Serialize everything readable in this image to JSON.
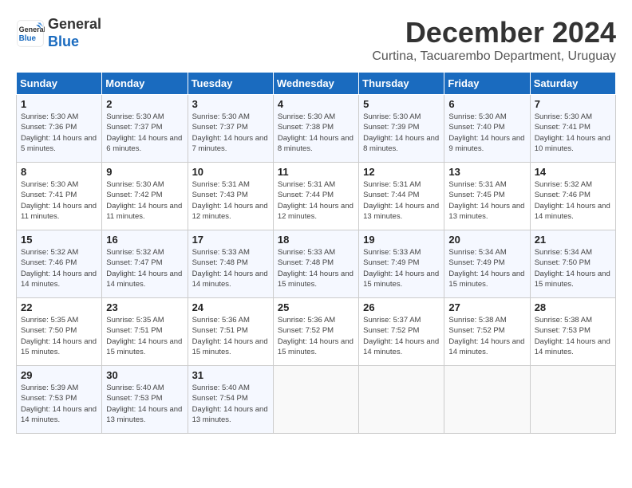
{
  "logo": {
    "line1": "General",
    "line2": "Blue"
  },
  "title": "December 2024",
  "subtitle": "Curtina, Tacuarembo Department, Uruguay",
  "weekdays": [
    "Sunday",
    "Monday",
    "Tuesday",
    "Wednesday",
    "Thursday",
    "Friday",
    "Saturday"
  ],
  "weeks": [
    [
      {
        "day": "1",
        "sunrise": "5:30 AM",
        "sunset": "7:36 PM",
        "daylight": "14 hours and 5 minutes."
      },
      {
        "day": "2",
        "sunrise": "5:30 AM",
        "sunset": "7:37 PM",
        "daylight": "14 hours and 6 minutes."
      },
      {
        "day": "3",
        "sunrise": "5:30 AM",
        "sunset": "7:37 PM",
        "daylight": "14 hours and 7 minutes."
      },
      {
        "day": "4",
        "sunrise": "5:30 AM",
        "sunset": "7:38 PM",
        "daylight": "14 hours and 8 minutes."
      },
      {
        "day": "5",
        "sunrise": "5:30 AM",
        "sunset": "7:39 PM",
        "daylight": "14 hours and 8 minutes."
      },
      {
        "day": "6",
        "sunrise": "5:30 AM",
        "sunset": "7:40 PM",
        "daylight": "14 hours and 9 minutes."
      },
      {
        "day": "7",
        "sunrise": "5:30 AM",
        "sunset": "7:41 PM",
        "daylight": "14 hours and 10 minutes."
      }
    ],
    [
      {
        "day": "8",
        "sunrise": "5:30 AM",
        "sunset": "7:41 PM",
        "daylight": "14 hours and 11 minutes."
      },
      {
        "day": "9",
        "sunrise": "5:30 AM",
        "sunset": "7:42 PM",
        "daylight": "14 hours and 11 minutes."
      },
      {
        "day": "10",
        "sunrise": "5:31 AM",
        "sunset": "7:43 PM",
        "daylight": "14 hours and 12 minutes."
      },
      {
        "day": "11",
        "sunrise": "5:31 AM",
        "sunset": "7:44 PM",
        "daylight": "14 hours and 12 minutes."
      },
      {
        "day": "12",
        "sunrise": "5:31 AM",
        "sunset": "7:44 PM",
        "daylight": "14 hours and 13 minutes."
      },
      {
        "day": "13",
        "sunrise": "5:31 AM",
        "sunset": "7:45 PM",
        "daylight": "14 hours and 13 minutes."
      },
      {
        "day": "14",
        "sunrise": "5:32 AM",
        "sunset": "7:46 PM",
        "daylight": "14 hours and 14 minutes."
      }
    ],
    [
      {
        "day": "15",
        "sunrise": "5:32 AM",
        "sunset": "7:46 PM",
        "daylight": "14 hours and 14 minutes."
      },
      {
        "day": "16",
        "sunrise": "5:32 AM",
        "sunset": "7:47 PM",
        "daylight": "14 hours and 14 minutes."
      },
      {
        "day": "17",
        "sunrise": "5:33 AM",
        "sunset": "7:48 PM",
        "daylight": "14 hours and 14 minutes."
      },
      {
        "day": "18",
        "sunrise": "5:33 AM",
        "sunset": "7:48 PM",
        "daylight": "14 hours and 15 minutes."
      },
      {
        "day": "19",
        "sunrise": "5:33 AM",
        "sunset": "7:49 PM",
        "daylight": "14 hours and 15 minutes."
      },
      {
        "day": "20",
        "sunrise": "5:34 AM",
        "sunset": "7:49 PM",
        "daylight": "14 hours and 15 minutes."
      },
      {
        "day": "21",
        "sunrise": "5:34 AM",
        "sunset": "7:50 PM",
        "daylight": "14 hours and 15 minutes."
      }
    ],
    [
      {
        "day": "22",
        "sunrise": "5:35 AM",
        "sunset": "7:50 PM",
        "daylight": "14 hours and 15 minutes."
      },
      {
        "day": "23",
        "sunrise": "5:35 AM",
        "sunset": "7:51 PM",
        "daylight": "14 hours and 15 minutes."
      },
      {
        "day": "24",
        "sunrise": "5:36 AM",
        "sunset": "7:51 PM",
        "daylight": "14 hours and 15 minutes."
      },
      {
        "day": "25",
        "sunrise": "5:36 AM",
        "sunset": "7:52 PM",
        "daylight": "14 hours and 15 minutes."
      },
      {
        "day": "26",
        "sunrise": "5:37 AM",
        "sunset": "7:52 PM",
        "daylight": "14 hours and 14 minutes."
      },
      {
        "day": "27",
        "sunrise": "5:38 AM",
        "sunset": "7:52 PM",
        "daylight": "14 hours and 14 minutes."
      },
      {
        "day": "28",
        "sunrise": "5:38 AM",
        "sunset": "7:53 PM",
        "daylight": "14 hours and 14 minutes."
      }
    ],
    [
      {
        "day": "29",
        "sunrise": "5:39 AM",
        "sunset": "7:53 PM",
        "daylight": "14 hours and 14 minutes."
      },
      {
        "day": "30",
        "sunrise": "5:40 AM",
        "sunset": "7:53 PM",
        "daylight": "14 hours and 13 minutes."
      },
      {
        "day": "31",
        "sunrise": "5:40 AM",
        "sunset": "7:54 PM",
        "daylight": "14 hours and 13 minutes."
      },
      null,
      null,
      null,
      null
    ]
  ]
}
